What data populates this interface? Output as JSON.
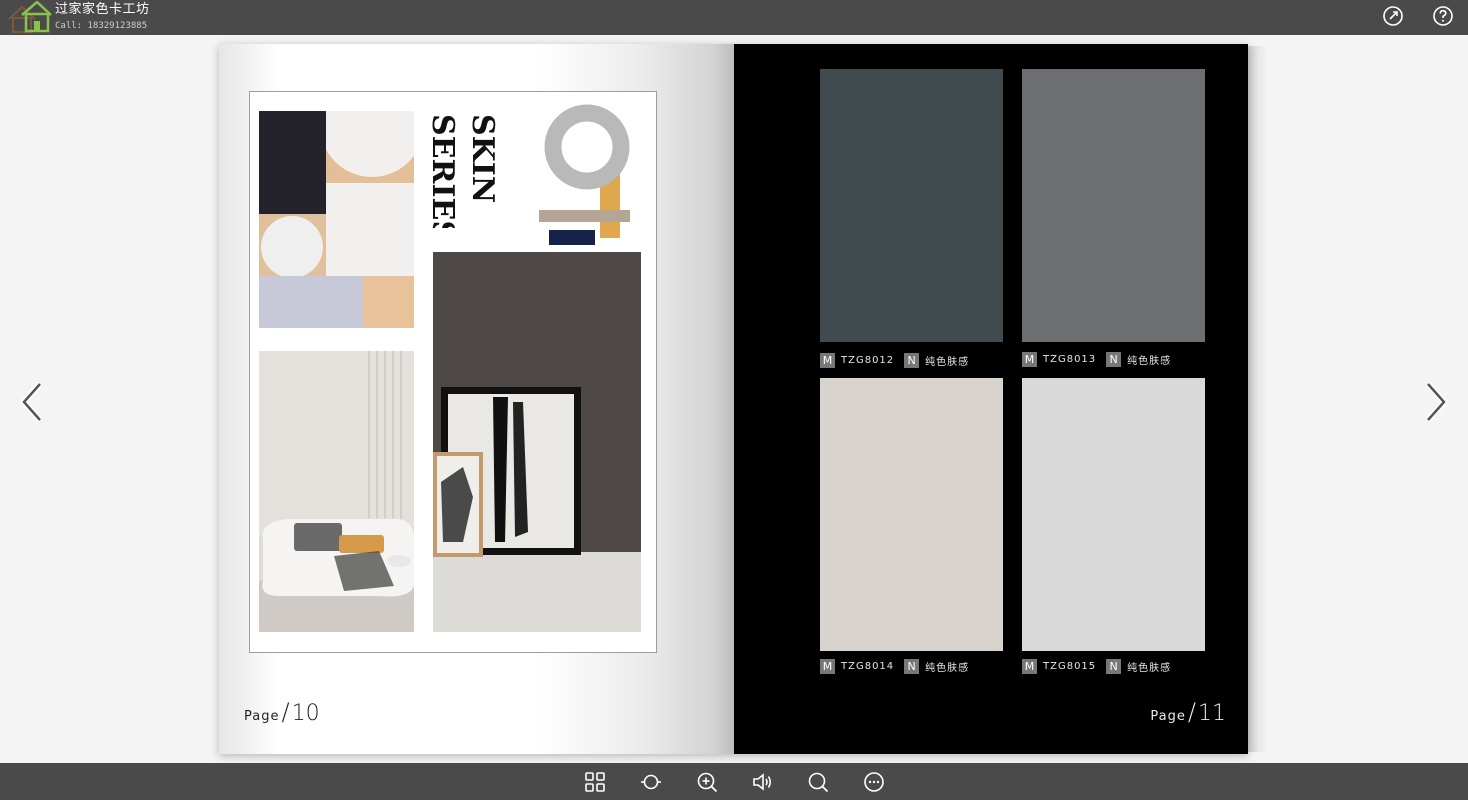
{
  "brand": {
    "name": "过家家色卡工坊",
    "call": "Call: 18329123885"
  },
  "toolbar_top": {
    "share_icon": "share-icon",
    "help_icon": "help-icon"
  },
  "navigation": {
    "prev_icon": "chevron-left-icon",
    "next_icon": "chevron-right-icon"
  },
  "left_page": {
    "title_line1": "SKIN",
    "title_line2": "SERIES",
    "page_label": "Page",
    "page_number": "10"
  },
  "right_page": {
    "page_label": "Page",
    "page_number": "11",
    "swatches": [
      {
        "m": "M",
        "code": "TZG8012",
        "n": "N",
        "name": "纯色肤感",
        "color": "#414a4f"
      },
      {
        "m": "M",
        "code": "TZG8013",
        "n": "N",
        "name": "纯色肤感",
        "color": "#6d6e71"
      },
      {
        "m": "M",
        "code": "TZG8014",
        "n": "N",
        "name": "纯色肤感",
        "color": "#d8d3cd"
      },
      {
        "m": "M",
        "code": "TZG8015",
        "n": "N",
        "name": "纯色肤感",
        "color": "#d9d9da"
      }
    ]
  },
  "bottom_toolbar": {
    "icons": [
      "grid-thumbnails-icon",
      "autoplay-icon",
      "zoom-in-icon",
      "sound-icon",
      "search-icon",
      "more-icon"
    ]
  }
}
